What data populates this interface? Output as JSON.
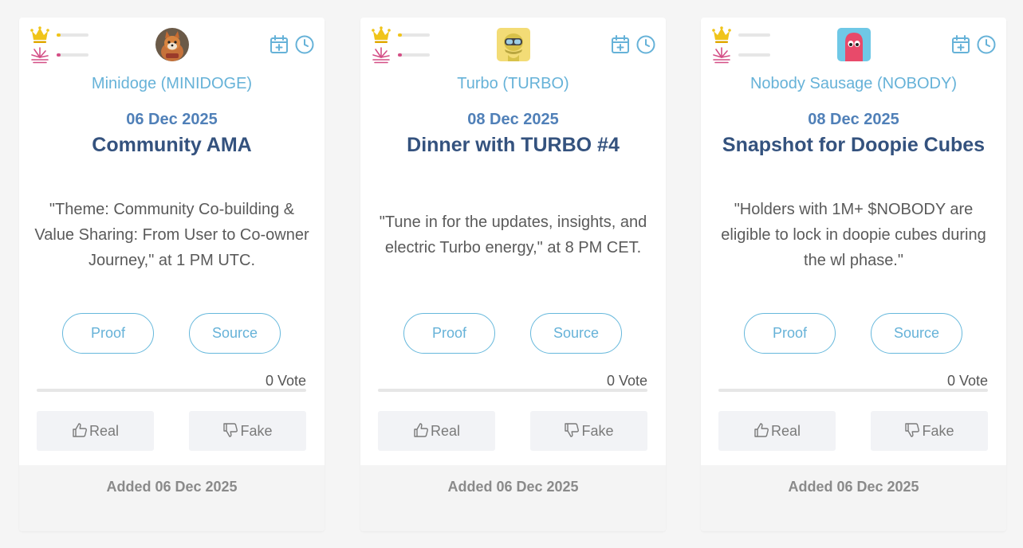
{
  "colors": {
    "accent": "#66b2d8",
    "date": "#5080b8",
    "title": "#34527e",
    "crown": "#f0c419",
    "rank": "#d44e86"
  },
  "icons": {
    "crown": "crown-icon",
    "trending": "sparkle-icon",
    "add_calendar": "calendar-plus-icon",
    "reminder": "clock-icon",
    "like": "thumbs-up-icon",
    "dislike": "thumbs-down-icon"
  },
  "cards": [
    {
      "coin": "Minidoge (MINIDOGE)",
      "date": "06 Dec 2025",
      "title": "Community AMA",
      "description": "\"Theme: Community Co-building & Value Sharing: From User to Co-owner Journey,\" at 1 PM UTC.",
      "proof_label": "Proof",
      "source_label": "Source",
      "votes_label": "0 Vote",
      "vote_progress": 0,
      "crown_level": 0.12,
      "hot_level": 0.12,
      "real_label": "Real",
      "fake_label": "Fake",
      "added": "Added 06 Dec 2025"
    },
    {
      "coin": "Turbo (TURBO)",
      "date": "08 Dec 2025",
      "title": "Dinner with TURBO #4",
      "description": "\"Tune in for the updates, insights, and electric Turbo energy,\" at 8 PM CET.",
      "proof_label": "Proof",
      "source_label": "Source",
      "votes_label": "0 Vote",
      "vote_progress": 0,
      "crown_level": 0.12,
      "hot_level": 0.12,
      "real_label": "Real",
      "fake_label": "Fake",
      "added": "Added 06 Dec 2025"
    },
    {
      "coin": "Nobody Sausage (NOBODY)",
      "date": "08 Dec 2025",
      "title": "Snapshot for Doopie Cubes",
      "description": "\"Holders with 1M+ $NOBODY are eligible to lock in doopie cubes during the wl phase.\"",
      "proof_label": "Proof",
      "source_label": "Source",
      "votes_label": "0 Vote",
      "vote_progress": 0,
      "crown_level": 0,
      "hot_level": 0,
      "real_label": "Real",
      "fake_label": "Fake",
      "added": "Added 06 Dec 2025"
    }
  ]
}
